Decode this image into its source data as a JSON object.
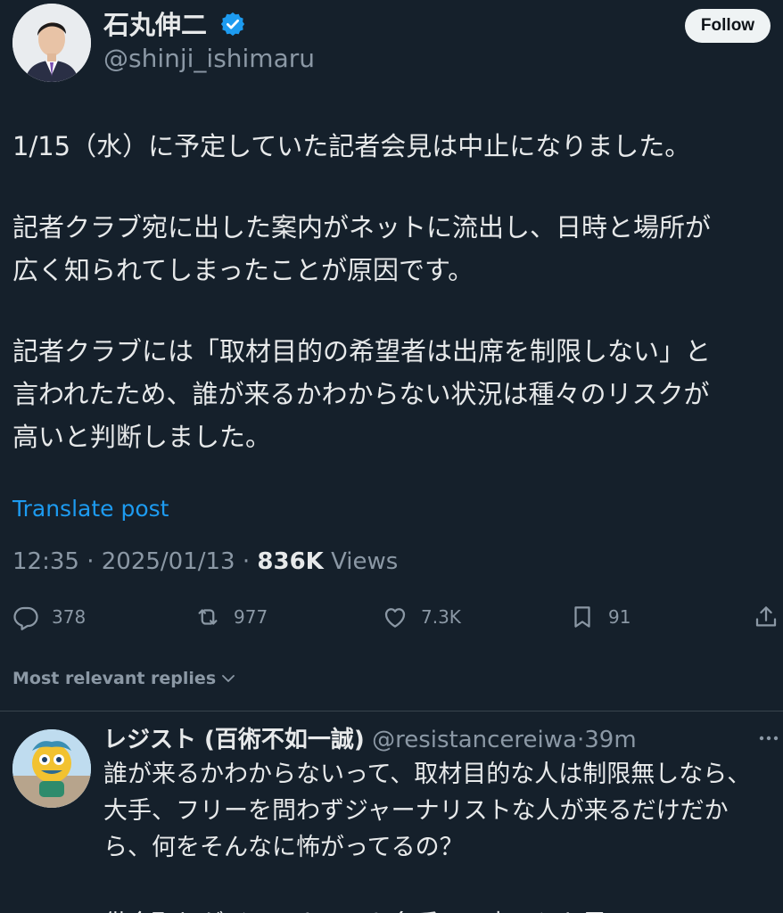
{
  "author": {
    "display_name": "石丸伸二",
    "handle": "@shinji_ishimaru",
    "verified": true,
    "follow_label": "Follow"
  },
  "post": {
    "paragraphs": [
      [
        "1/15（水）に予定していた記者会見は中止になりました。"
      ],
      [
        "記者クラブ宛に出した案内がネットに流出し、日時と場所が",
        "広く知られてしまったことが原因です。"
      ],
      [
        "記者クラブには「取材目的の希望者は出席を制限しない」と",
        "言われたため、誰が来るかわからない状況は種々のリスクが",
        "高いと判断しました。"
      ]
    ],
    "translate_label": "Translate post",
    "time": "12:35",
    "date": "2025/01/13",
    "views_count": "836K",
    "views_label": "Views",
    "separator": "·"
  },
  "actions": {
    "replies": "378",
    "reposts": "977",
    "likes": "7.3K",
    "bookmarks": "91"
  },
  "replies_filter": {
    "label": "Most relevant replies"
  },
  "reply": {
    "display_name": "レジスト (百術不如一誠)",
    "handle": "@resistancereiwa",
    "separator": "·",
    "time_ago": "39m",
    "lines": [
      "誰が来るかわからないって、取材目的な人は制限無しなら、",
      "大手、フリーを問わずジャーナリストな人が来るだけだか",
      "ら、何をそんなに怖がってるの？",
      "",
      "借金取りがジャーナリスト名乗って来るとか思ってる？"
    ]
  },
  "colors": {
    "background": "#15202b",
    "text": "#e7e9ea",
    "muted": "#8b98a5",
    "link": "#1d9bf0",
    "verified": "#1d9bf0"
  },
  "icons": {
    "reply": "reply-icon",
    "repost": "repost-icon",
    "like": "heart-icon",
    "bookmark": "bookmark-icon",
    "share": "share-icon",
    "more": "more-icon",
    "verified": "verified-badge-icon",
    "chevron": "chevron-down-icon"
  }
}
